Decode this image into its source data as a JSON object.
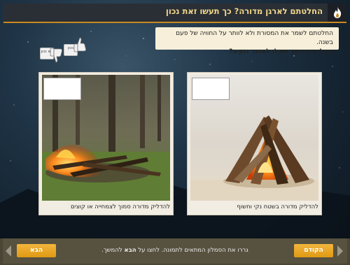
{
  "header": {
    "title": "החלטתם לארגן מדורה?  כך תעשו זאת נכון",
    "logo_icon": "fire-icon"
  },
  "instruction": {
    "line1": "החלטתם לשמר את המסורת ולא לוותר על החוויה של פעם בשנה.",
    "line2": "ובכל זאת-כיצד תוכלו למזער נזקים?"
  },
  "stickers": {
    "no_label": "לא נכון",
    "yes_label": "נכון"
  },
  "cards": [
    {
      "caption": "להדליק מדורה בשטח נקי וחשוף",
      "image_icon": "bonfire-on-sand-image"
    },
    {
      "caption": "להדליק מדורה סמוך לצמחייה או קוצים",
      "image_icon": "bonfire-in-forest-image"
    }
  ],
  "footer": {
    "prev_label": "הקודם",
    "next_label": "הבא",
    "hint_part1": "גררו את הסמלון המתאים לתמונה. לחצו על",
    "hint_bold": "הבא",
    "hint_part2": "להמשך."
  },
  "colors": {
    "accent": "#f0a92a",
    "title_text": "#f2d88a",
    "title_bar": "#2a2f36",
    "bottom_bar": "#57513f"
  }
}
